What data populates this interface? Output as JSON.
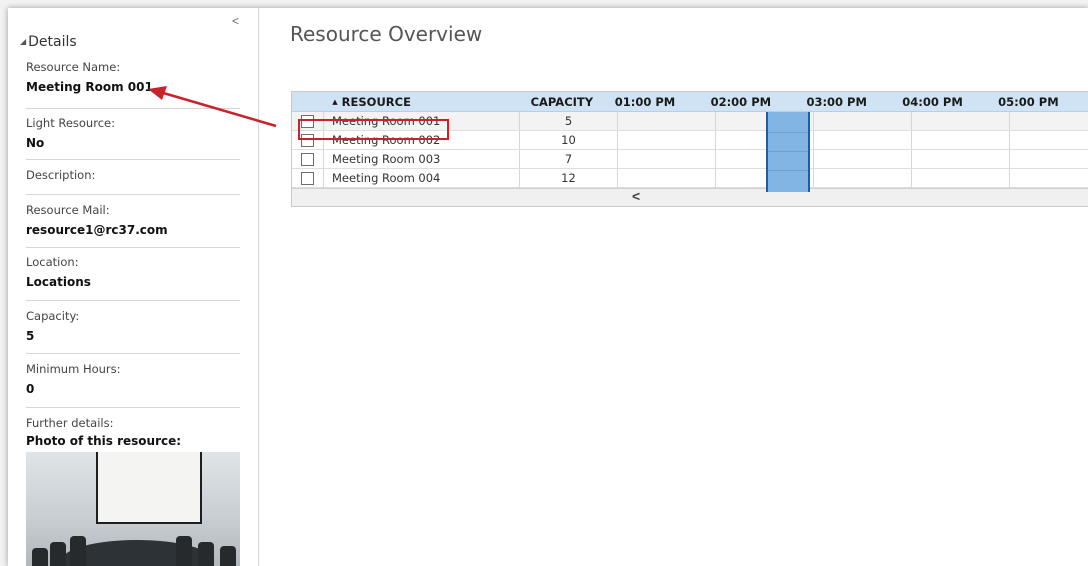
{
  "sidebar": {
    "collapse_glyph": "<",
    "header": "Details",
    "fields": [
      {
        "label": "Resource Name:",
        "value": "Meeting Room 001"
      },
      {
        "label": "Light Resource:",
        "value": "No"
      },
      {
        "label": "Description:",
        "value": ""
      },
      {
        "label": "Resource Mail:",
        "value": "resource1@rc37.com"
      },
      {
        "label": "Location:",
        "value": "Locations"
      },
      {
        "label": "Capacity:",
        "value": "5"
      },
      {
        "label": "Minimum Hours:",
        "value": "0"
      }
    ],
    "further_details_label": "Further details:",
    "photo_label": "Photo of this resource:"
  },
  "main": {
    "title": "Resource Overview",
    "grid": {
      "columns": {
        "resource": "RESOURCE",
        "capacity": "CAPACITY",
        "times": [
          "01:00 PM",
          "02:00 PM",
          "03:00 PM",
          "04:00 PM",
          "05:00 PM"
        ]
      },
      "rows": [
        {
          "name": "Meeting Room 001",
          "capacity": "5"
        },
        {
          "name": "Meeting Room 002",
          "capacity": "10"
        },
        {
          "name": "Meeting Room 003",
          "capacity": "7"
        },
        {
          "name": "Meeting Room 004",
          "capacity": "12"
        }
      ],
      "scroll_glyph": "<"
    }
  },
  "colors": {
    "header_bg": "#cfe3f4",
    "booking_fill": "#83b5e3",
    "booking_border": "#1a5ea3",
    "annotation_red": "#c8232b"
  }
}
